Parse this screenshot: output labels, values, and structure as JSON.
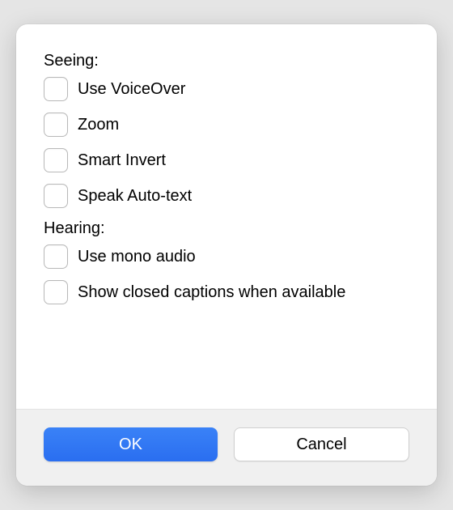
{
  "sections": {
    "seeing": {
      "label": "Seeing:",
      "options": [
        {
          "id": "voiceover",
          "label": "Use VoiceOver",
          "checked": false
        },
        {
          "id": "zoom",
          "label": "Zoom",
          "checked": false
        },
        {
          "id": "smart-invert",
          "label": "Smart Invert",
          "checked": false
        },
        {
          "id": "speak-auto-text",
          "label": "Speak Auto-text",
          "checked": false
        }
      ]
    },
    "hearing": {
      "label": "Hearing:",
      "options": [
        {
          "id": "mono-audio",
          "label": "Use mono audio",
          "checked": false
        },
        {
          "id": "closed-captions",
          "label": "Show closed captions when available",
          "checked": false
        }
      ]
    }
  },
  "buttons": {
    "ok": "OK",
    "cancel": "Cancel"
  }
}
